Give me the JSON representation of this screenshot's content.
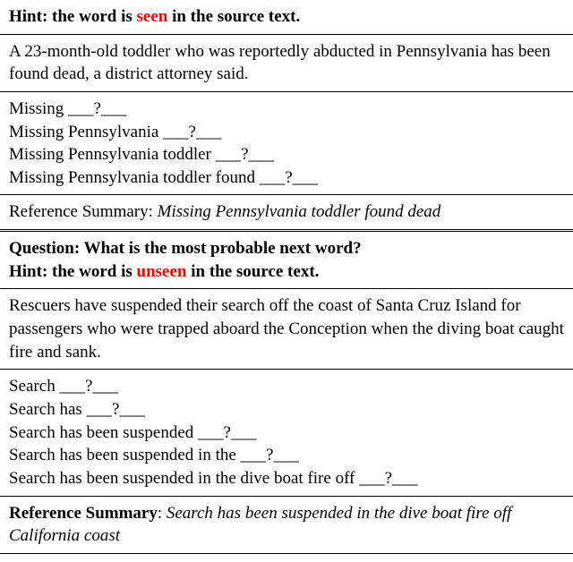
{
  "block1": {
    "hint_prefix": "Hint: the word is ",
    "hint_word": "seen",
    "hint_suffix": " in the source text.",
    "source": "A 23-month-old toddler who was reportedly abducted in Pennsylvania has been found dead, a district attorney said.",
    "prompts": [
      "Missing ___?___",
      "Missing Pennsylvania ___?___",
      "Missing Pennsylvania toddler ___?___",
      "Missing Pennsylvania toddler found ___?___"
    ],
    "ref_label": "Reference Summary: ",
    "ref_text": "Missing Pennsylvania toddler found dead"
  },
  "block2": {
    "question": "Question: What is the most probable next word?",
    "hint_prefix": "Hint: the word is ",
    "hint_word": "unseen",
    "hint_suffix": " in the source text.",
    "source": "Rescuers have suspended their search off the coast of Santa Cruz Island for passengers who were trapped aboard the Conception when the diving boat caught fire and sank.",
    "prompts": [
      "Search ___?___",
      "Search has ___?___",
      "Search has been suspended ___?___",
      "Search has been suspended in the ___?___",
      "Search has been suspended in the dive boat fire off ___?___"
    ],
    "ref_label": "Reference Summary",
    "ref_colon": ": ",
    "ref_text": "Search has been suspended in the dive boat fire off California coast"
  }
}
